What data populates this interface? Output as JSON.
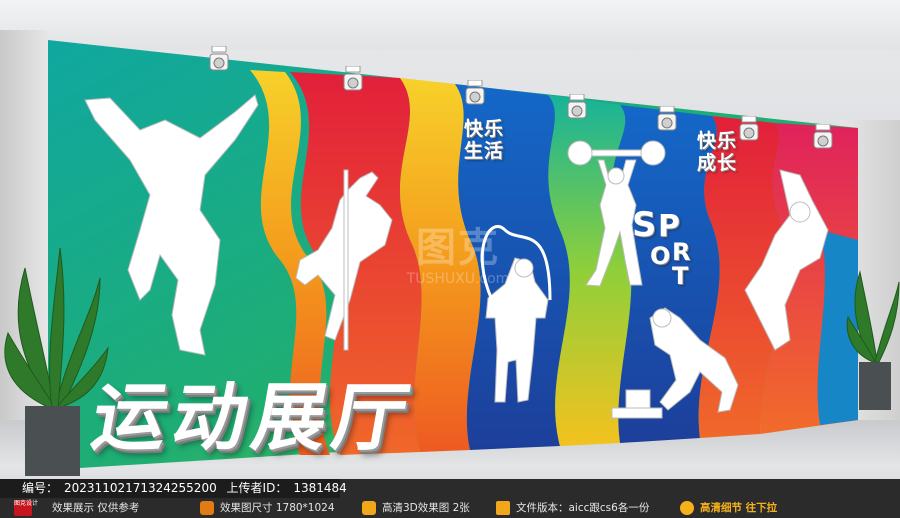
{
  "wall": {
    "tagline_left": [
      "快乐",
      "生活"
    ],
    "tagline_right": [
      "快乐",
      "成长"
    ],
    "sport_letters": [
      "S",
      "P",
      "O",
      "R",
      "T"
    ],
    "main_title": "运动展厅"
  },
  "watermark": {
    "mark": "图克",
    "sub": "TUSHUXU.com"
  },
  "info_bar": {
    "id_label": "编号：",
    "id_value": "20231102171324255200",
    "uploader_label": "上传者ID：",
    "uploader_value": "1381484",
    "preview_note": "效果展示  仅供参考",
    "size_label": "效果图尺寸 1780*1024",
    "hd_label": "高清3D效果图 2张",
    "version_label": "文件版本：aicc跟cs6各一份",
    "detail_label": "高清细节 往下拉",
    "logo_text": "图克设计"
  },
  "colors": {
    "teal": "#1aa889",
    "yellow": "#f4c21f",
    "red": "#e8322b",
    "blue": "#1f5fb8",
    "highlight": "#f6b21a"
  }
}
